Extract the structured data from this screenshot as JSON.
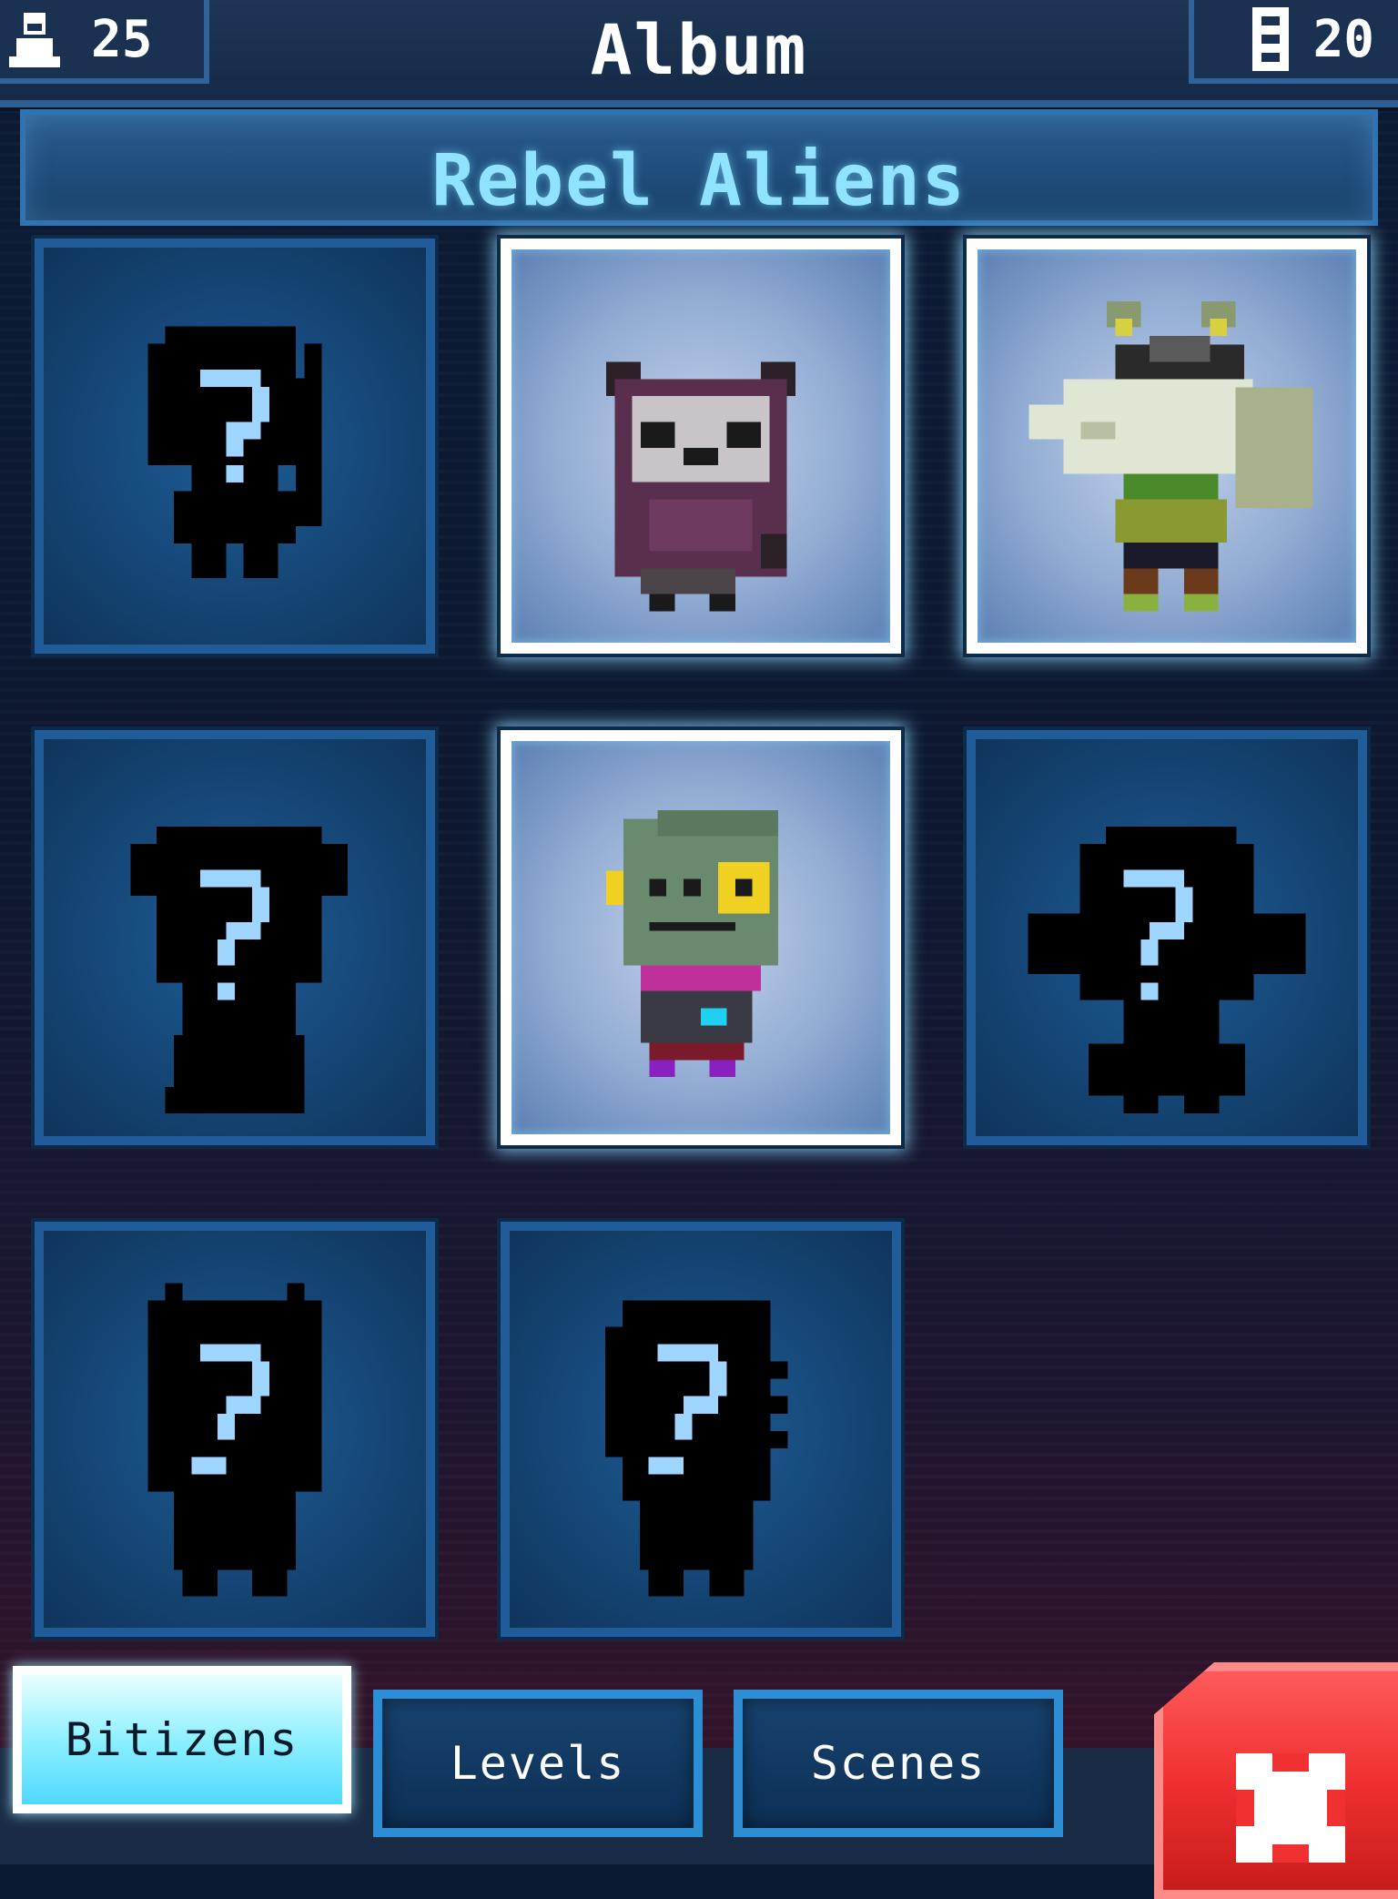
{
  "header": {
    "title": "Album",
    "population_count": "25",
    "floors_count": "20",
    "population_icon": "person-icon",
    "floors_icon": "floors-icon"
  },
  "category": {
    "title": "Rebel Aliens"
  },
  "album": {
    "cards": [
      {
        "name": "card-1",
        "state": "locked"
      },
      {
        "name": "card-2",
        "state": "unlocked",
        "character": "hooded-panda-alien"
      },
      {
        "name": "card-3",
        "state": "unlocked",
        "character": "goggled-wolf-alien"
      },
      {
        "name": "card-4",
        "state": "locked"
      },
      {
        "name": "card-5",
        "state": "unlocked",
        "character": "green-cyclops-alien"
      },
      {
        "name": "card-6",
        "state": "locked"
      },
      {
        "name": "card-7",
        "state": "locked"
      },
      {
        "name": "card-8",
        "state": "locked"
      }
    ]
  },
  "tabs": [
    {
      "label": "Bitizens",
      "active": true
    },
    {
      "label": "Levels",
      "active": false
    },
    {
      "label": "Scenes",
      "active": false
    }
  ],
  "close_button": {
    "icon": "close-icon"
  },
  "colors": {
    "accent_cyan": "#8fe3ff",
    "card_border_locked": "#1f5c99",
    "card_border_unlocked": "#ffffff",
    "close_red": "#f03030"
  }
}
